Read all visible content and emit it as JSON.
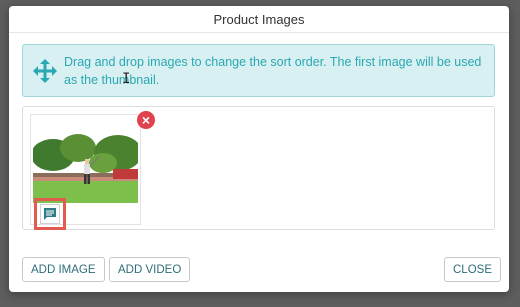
{
  "modal": {
    "title": "Product Images"
  },
  "info": {
    "text": "Drag and drop images to change the sort order. The first image will be used as the thumbnail.",
    "icon": "move-icon"
  },
  "gallery": {
    "images": [
      {
        "description_icon": "golf-photo",
        "remove_label": "×"
      }
    ]
  },
  "footer": {
    "add_image_label": "ADD IMAGE",
    "add_video_label": "ADD VIDEO",
    "close_label": "CLOSE"
  },
  "colors": {
    "accent": "#2aa8b3",
    "alert_bg": "#d8f0f1",
    "remove": "#e0434d",
    "highlight": "#e35a4f",
    "button_text": "#2d6d78"
  }
}
